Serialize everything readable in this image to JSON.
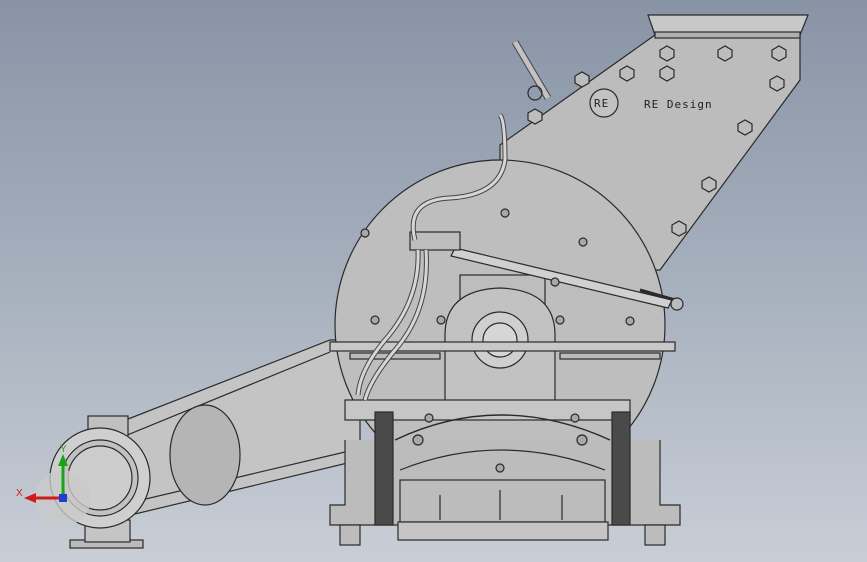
{
  "model": {
    "logo_text": "RE Design",
    "logo_mark": "RE"
  },
  "triad": {
    "x_label": "X",
    "y_label": "Y",
    "x_color": "#d11a1a",
    "y_color": "#19a319",
    "z_color": "#1a3fd1"
  },
  "colors": {
    "body": "#bdbdbd",
    "body_dark": "#9d9d9d",
    "outline": "#2a2a2a",
    "dark_plate": "#4a4a4a",
    "background_top": "#8894a6",
    "background_bottom": "#c9ced6"
  }
}
